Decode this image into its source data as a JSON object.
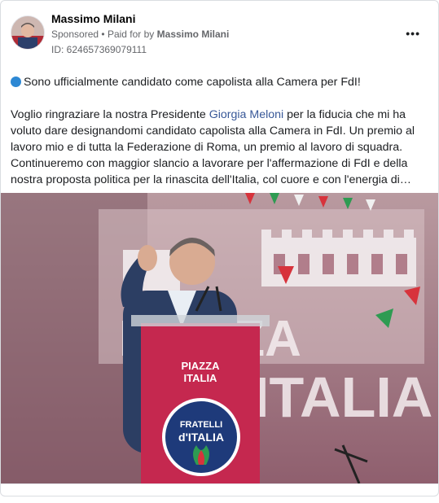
{
  "post": {
    "author": "Massimo Milani",
    "sponsored_label": "Sponsored",
    "paid_prefix": "Paid for by",
    "paid_by": "Massimo Milani",
    "ad_id": "ID: 624657369079111",
    "more_label": "•••",
    "headline": "Sono ufficialmente candidato come capolista alla Camera per FdI!",
    "body_before_link": "Voglio ringraziare la nostra Presidente ",
    "body_link": "Giorgia Meloni",
    "body_after_link": " per la fiducia che mi ha voluto dare designandomi candidato capolista alla Camera in FdI. Un premio al lavoro mio e di tutta la Federazione di Roma, un premio al lavoro di squadra. Continueremo con maggior slancio a lavorare per l'affermazione di FdI e della nostra proposta politica per la rinascita dell'Italia, col cuore e con l'energia di…"
  },
  "image": {
    "backdrop_text": "PIAZZA ITALIA",
    "podium_sign": [
      "PIAZZA",
      "ITALIA"
    ],
    "party_logo": [
      "FRATELLI",
      "d'ITALIA"
    ]
  }
}
